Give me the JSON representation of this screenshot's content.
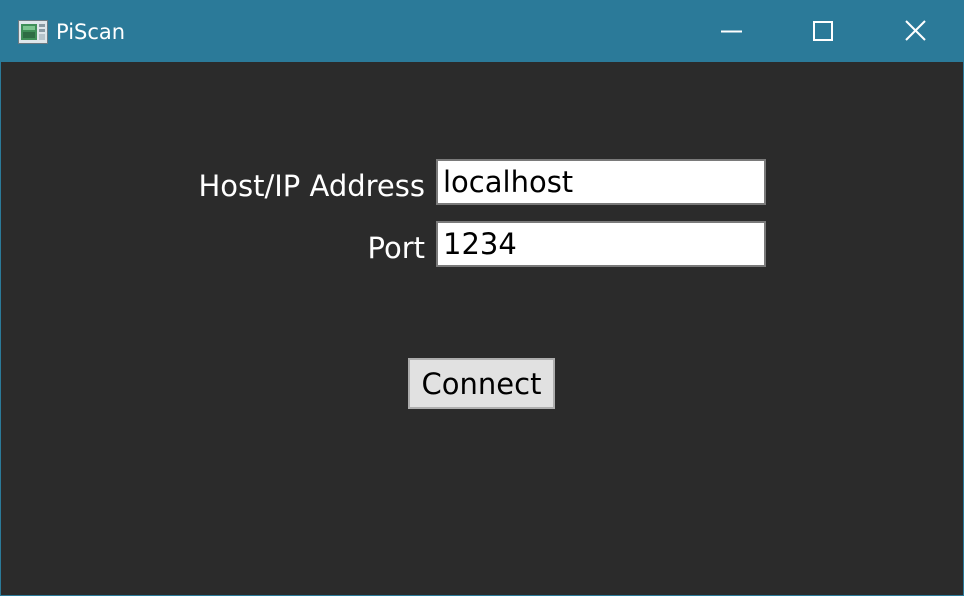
{
  "window": {
    "title": "PiScan",
    "title_bar_color": "#2b7a99",
    "background_color": "#2b2b2b"
  },
  "titlebar": {
    "app_icon": "piscan-app-icon",
    "minimize_icon": "minimize-icon",
    "maximize_icon": "maximize-icon",
    "close_icon": "close-icon"
  },
  "form": {
    "host_label": "Host/IP Address",
    "host_value": "localhost",
    "port_label": "Port",
    "port_value": "1234",
    "connect_label": "Connect"
  }
}
